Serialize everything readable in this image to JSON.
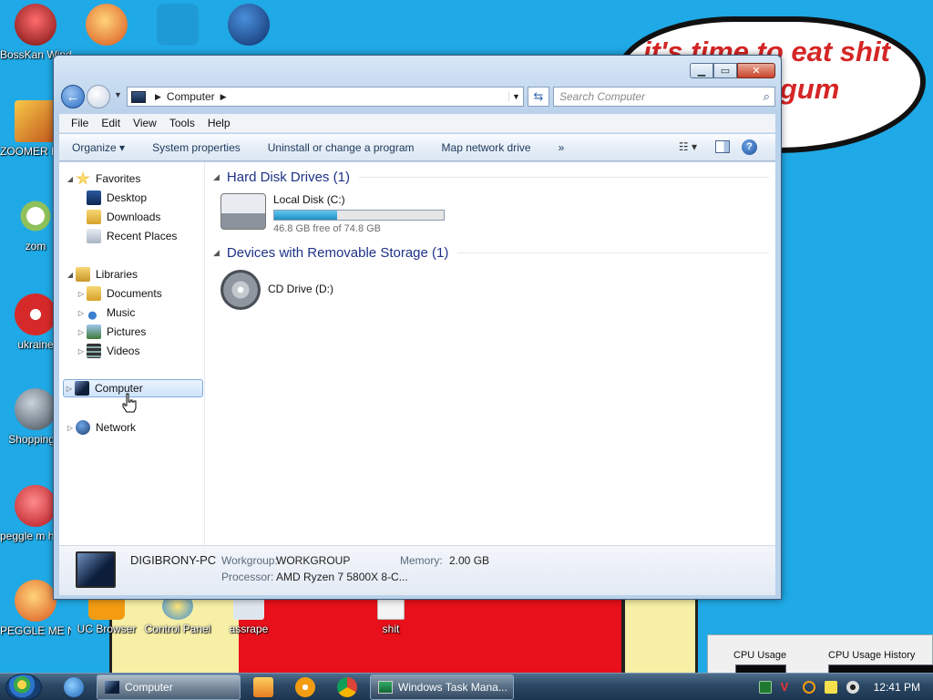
{
  "desktop": {
    "speech_text": "it's time to eat shit and chew gum",
    "icons": [
      {
        "label": "BossKan Windows",
        "color": "#c0392b"
      },
      {
        "label": "ZOOMER DELUXE",
        "color": "#e67e22"
      },
      {
        "label": "zom",
        "color": "#ecf0f1"
      },
      {
        "label": "ukraine",
        "color": "#d62a2a"
      },
      {
        "label": "ShoppingC",
        "color": "#6f7e8b"
      },
      {
        "label": "peggle m heggle",
        "color": "#e74c3c"
      },
      {
        "label": "PEGGLE ME NECKBEA...",
        "color": "#e67e22"
      },
      {
        "label": "UC Browser",
        "color": "#f39c12"
      },
      {
        "label": "Control Panel",
        "color": "#3b8ed6"
      },
      {
        "label": "assrape",
        "color": "#dfe7ee"
      },
      {
        "label": "shit",
        "color": "#f4f4f4"
      }
    ]
  },
  "window": {
    "title": "Computer",
    "address_path": [
      "Computer"
    ],
    "search_placeholder": "Search Computer",
    "menu": [
      "File",
      "Edit",
      "View",
      "Tools",
      "Help"
    ],
    "commands": [
      "Organize ▾",
      "System properties",
      "Uninstall or change a program",
      "Map network drive"
    ],
    "more_chevron": "»",
    "nav": {
      "favorites": {
        "label": "Favorites",
        "items": [
          "Desktop",
          "Downloads",
          "Recent Places"
        ]
      },
      "libraries": {
        "label": "Libraries",
        "items": [
          "Documents",
          "Music",
          "Pictures",
          "Videos"
        ]
      },
      "computer": "Computer",
      "network": "Network"
    },
    "groups": {
      "hdd": {
        "title": "Hard Disk Drives (1)",
        "drive_name": "Local Disk (C:)",
        "free_text": "46.8 GB free of 74.8 GB",
        "used_fraction": 0.37
      },
      "removable": {
        "title": "Devices with Removable Storage (1)",
        "drive_name": "CD Drive (D:)"
      }
    },
    "details": {
      "pc_name": "DIGIBRONY-PC",
      "workgroup_label": "Workgroup:",
      "workgroup": "WORKGROUP",
      "memory_label": "Memory:",
      "memory": "2.00 GB",
      "processor_label": "Processor:",
      "processor": "AMD Ryzen 7 5800X 8-C..."
    }
  },
  "task_manager": {
    "cpu_usage": "CPU Usage",
    "cpu_history": "CPU Usage History"
  },
  "taskbar": {
    "buttons": [
      "Computer",
      "Windows Task Mana..."
    ],
    "clock": "12:41 PM"
  }
}
